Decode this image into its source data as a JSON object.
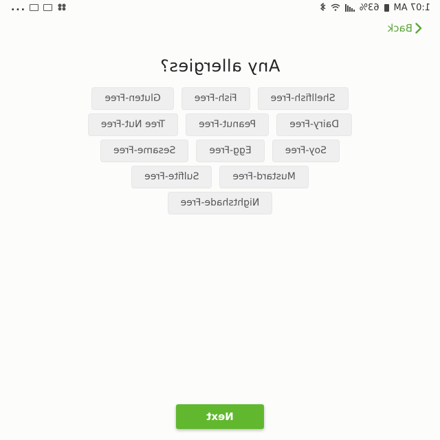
{
  "status_bar": {
    "time": "1:07 AM",
    "battery": "63%",
    "overflow": "..."
  },
  "nav": {
    "back_label": "Back"
  },
  "title": "Any allergies?",
  "allergy_rows": [
    [
      "Shellfish-Free",
      "Fish-Free",
      "Gluten-Free"
    ],
    [
      "Dairy-Free",
      "Peanut-Free",
      "Tree Nut-Free"
    ],
    [
      "Soy-Free",
      "Egg-Free",
      "Sesame-Free"
    ],
    [
      "Mustard-Free",
      "Sulfite-Free"
    ],
    [
      "Nightshade-Free"
    ]
  ],
  "next_label": "Next",
  "colors": {
    "accent": "#61b82f",
    "back_text": "#5aa63a",
    "chip_bg": "#efeff0"
  },
  "icons": {
    "back": "chevron-left-icon",
    "status": [
      "gallery-icon",
      "mail-icon",
      "pinwheel-icon",
      "bluetooth-icon",
      "wifi-icon",
      "signal-icon",
      "battery-icon"
    ]
  }
}
